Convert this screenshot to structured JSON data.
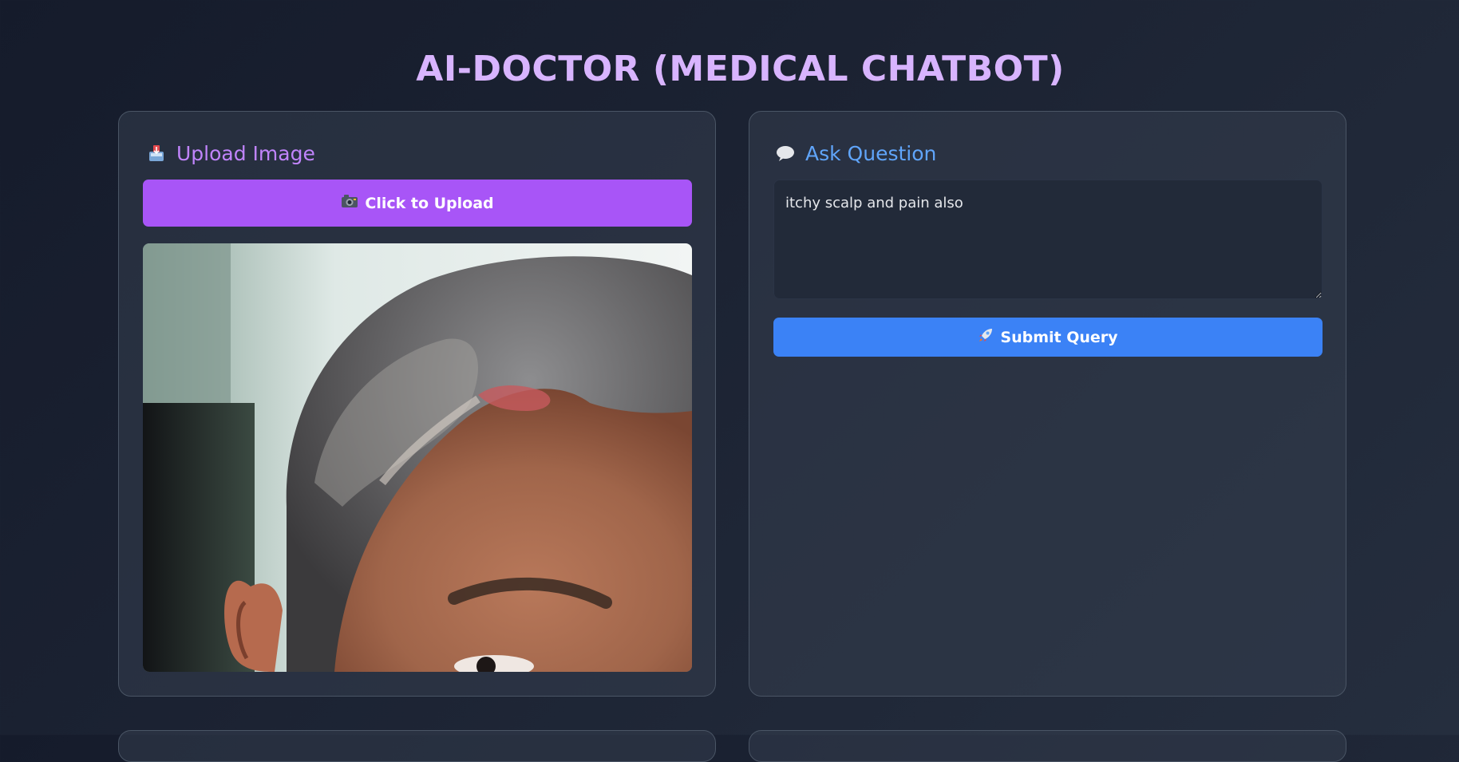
{
  "page": {
    "title": "AI-DOCTOR (MEDICAL CHATBOT)"
  },
  "upload_panel": {
    "heading": "Upload Image",
    "heading_icon": "inbox-tray-icon",
    "button_label": "Click to Upload",
    "button_icon": "camera-icon",
    "image_description_icon": "uploaded-scalp-photo"
  },
  "question_panel": {
    "heading": "Ask Question",
    "heading_icon": "speech-balloon-icon",
    "input_value": "itchy scalp and pain also",
    "submit_label": "Submit Query",
    "submit_icon": "rocket-icon"
  },
  "colors": {
    "title": "#d8b4fe",
    "upload_accent": "#a855f7",
    "upload_heading": "#c084fc",
    "question_heading": "#60a5fa",
    "submit_accent": "#3b82f6"
  }
}
